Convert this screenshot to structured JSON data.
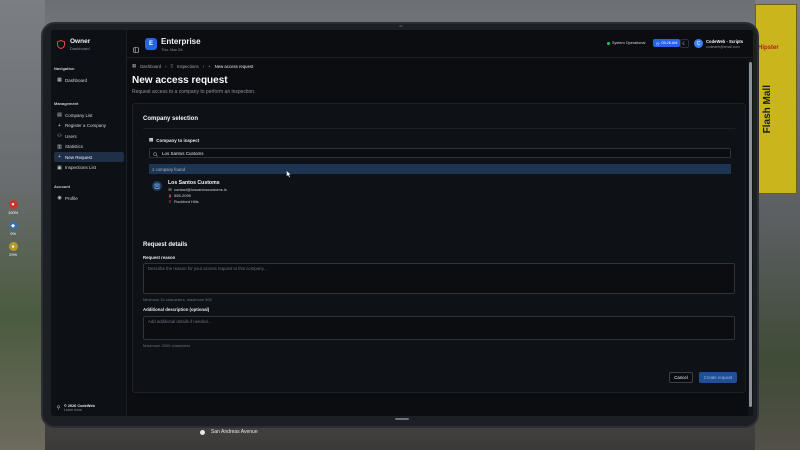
{
  "background": {
    "sign_text": "Flash Mall",
    "sign_sub": "Hipster",
    "street": "San Andreas Avenue",
    "hud": [
      {
        "icon": "heart-icon",
        "value": "100%",
        "color": "#c0392b"
      },
      {
        "icon": "shield-icon",
        "value": "0%",
        "color": "#3b6ea5"
      },
      {
        "icon": "food-icon",
        "value": "29%",
        "color": "#b89a2a"
      }
    ]
  },
  "sidebar": {
    "brand_title": "Owner",
    "brand_sub": "Dashboard",
    "nav_heading": "Navigation",
    "nav_items": [
      {
        "label": "Dashboard",
        "icon": "grid-icon"
      }
    ],
    "management_heading": "Management",
    "management_items": [
      {
        "label": "Company List",
        "icon": "building-icon"
      },
      {
        "label": "Register a Company",
        "icon": "plus-icon"
      },
      {
        "label": "Users",
        "icon": "users-icon"
      },
      {
        "label": "Statistics",
        "icon": "chart-icon"
      },
      {
        "label": "New Request",
        "icon": "plus-icon",
        "active": true
      },
      {
        "label": "Inspections List",
        "icon": "clipboard-icon"
      }
    ],
    "account_heading": "Account",
    "account_items": [
      {
        "label": "Profile",
        "icon": "user-icon"
      }
    ],
    "footer_title": "© 2026 CodeWeb",
    "footer_sub": "Learn more"
  },
  "header": {
    "badge": "E",
    "title": "Enterprise",
    "date": "Thu, Mar 26",
    "status": "System Operational",
    "time": "05:26 AM",
    "user_initial": "C",
    "user_name": "CodeWeb - Scripts",
    "user_email": "codeweb@email.com"
  },
  "breadcrumb": {
    "items": [
      "Dashboard",
      "Inspections"
    ],
    "current": "New access request"
  },
  "page": {
    "title": "New access request",
    "subtitle": "Request access to a company to perform an inspection."
  },
  "company_selection": {
    "title": "Company selection",
    "label": "Company to inspect",
    "search_value": "Los Santos Customs",
    "found_text": "1 company found",
    "result": {
      "name": "Los Santos Customs",
      "email": "contact@lossantoscustoms.ls",
      "phone": "555-2099",
      "location": "Rockford Hills"
    }
  },
  "request_details": {
    "title": "Request details",
    "reason_label": "Request reason",
    "reason_placeholder": "Describe the reason for your access request to this company...",
    "reason_hint": "Minimum 10 characters, maximum 500",
    "desc_label": "Additional description (optional)",
    "desc_placeholder": "Add additional details if needed...",
    "desc_hint": "Maximum 2000 characters"
  },
  "actions": {
    "cancel": "Cancel",
    "create": "Create request"
  },
  "colors": {
    "accent": "#2563eb",
    "active_nav": "#1f2f48",
    "status_ok": "#22c55e"
  }
}
